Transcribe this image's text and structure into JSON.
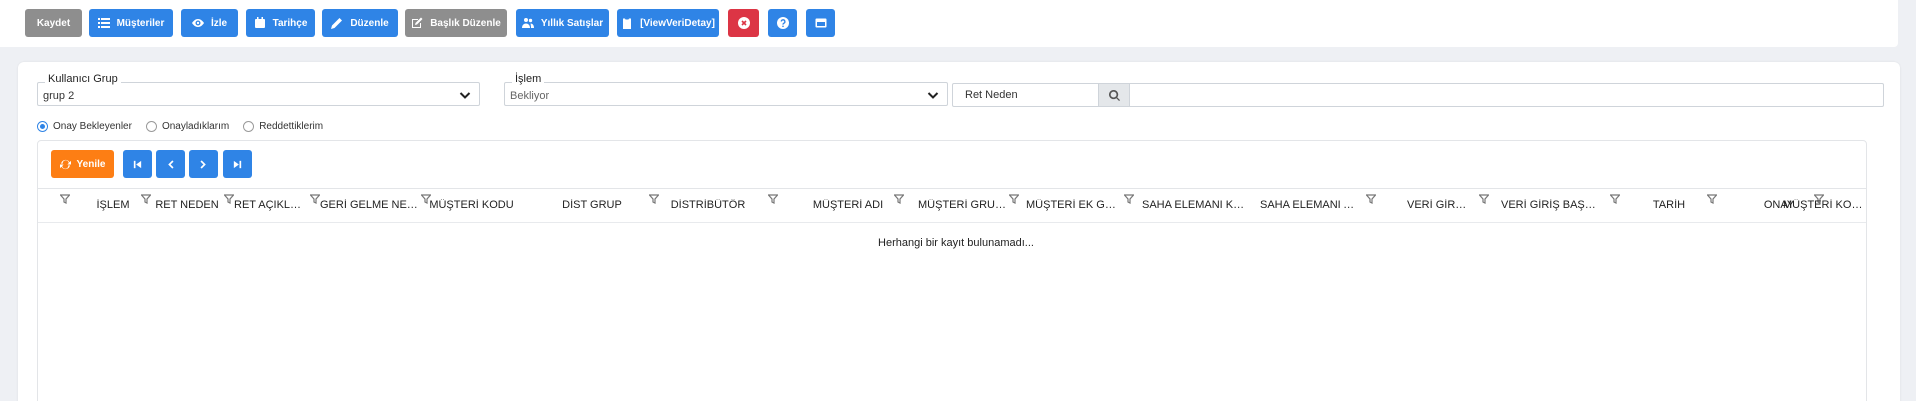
{
  "toolbar": {
    "buttons": [
      {
        "label": "Kaydet",
        "icon": "save-icon",
        "color": "#8e8e8e"
      },
      {
        "label": "Müşteriler",
        "icon": "list-icon",
        "color": "#2f84e6"
      },
      {
        "label": "İzle",
        "icon": "eye-icon",
        "color": "#2f84e6"
      },
      {
        "label": "Tarihçe",
        "icon": "calendar-icon",
        "color": "#2f84e6"
      },
      {
        "label": "Düzenle",
        "icon": "pencil-icon",
        "color": "#2f84e6"
      },
      {
        "label": "Başlık Düzenle",
        "icon": "edit-icon",
        "color": "#8e8e8e"
      },
      {
        "label": "Yıllık Satışlar",
        "icon": "users-icon",
        "color": "#2f84e6"
      },
      {
        "label": "[ViewVeriDetay]",
        "icon": "clipboard-icon",
        "color": "#2f84e6"
      },
      {
        "label": "",
        "icon": "close-circle-icon",
        "color": "#dc3545"
      },
      {
        "label": "",
        "icon": "help-icon",
        "color": "#2f84e6"
      },
      {
        "label": "",
        "icon": "window-icon",
        "color": "#2f84e6"
      }
    ]
  },
  "filters": {
    "kullanici_grup": {
      "label": "Kullanıcı Grup",
      "value": "grup 2"
    },
    "islem": {
      "label": "İşlem",
      "value": "Bekliyor"
    },
    "ret_neden": {
      "label": "Ret Neden",
      "value": ""
    }
  },
  "radios": [
    {
      "label": "Onay Bekleyenler",
      "checked": true
    },
    {
      "label": "Onayladıklarım",
      "checked": false
    },
    {
      "label": "Reddettiklerim",
      "checked": false
    }
  ],
  "grid": {
    "refresh_label": "Yenile",
    "columns": [
      "İŞLEM",
      "RET NEDEN",
      "RET AÇIKLAMA",
      "GERİ GELME NEDENİ",
      "MÜŞTERİ KODU",
      "DİST GRUP",
      "DİSTRİBÜTÖR",
      "MÜŞTERİ ADI",
      "MÜŞTERİ GRUBU",
      "MÜŞTERİ EK GRU...",
      "SAHA ELEMANI KOD",
      "SAHA ELEMANI ADI",
      "VERİ GİRİŞİ",
      "VERİ GİRİŞ BAŞLIK",
      "TARİH",
      "ONAY",
      "MÜŞTERİ KODU"
    ],
    "empty_text": "Herhangi bir kayıt bulunamadı..."
  },
  "colors": {
    "primary": "#2f84e6",
    "secondary": "#8e8e8e",
    "danger": "#dc3545",
    "warning": "#fd7e14"
  }
}
